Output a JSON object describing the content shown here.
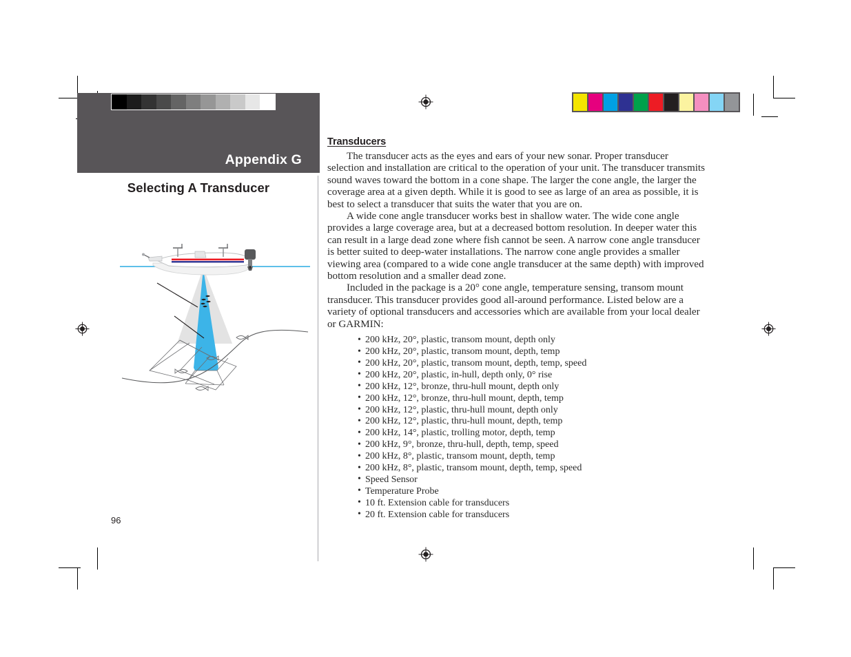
{
  "page": {
    "number": "96",
    "appendix_label": "Appendix G",
    "section_title": "Selecting A Transducer",
    "background_color": "#ffffff",
    "panel_color": "#585558"
  },
  "body": {
    "heading": "Transducers",
    "paragraphs": [
      "The transducer acts as the eyes and ears of your new sonar. Proper transducer selection and installation are critical to the operation of your unit. The transducer transmits sound waves toward the bottom in a cone shape. The larger the cone angle, the larger the coverage area at a given depth. While it is good to see as large of an area as possible, it is best to select a transducer that suits the water that you are on.",
      "A wide cone angle transducer works best in shallow water. The wide cone angle provides a large coverage area, but at a decreased bottom resolution. In deeper water this can result in a large dead zone where fish cannot be seen. A narrow cone angle transducer is better suited to deep-water installations. The narrow cone angle provides a smaller viewing area (compared to a wide cone angle transducer at the same depth) with improved bottom resolution and a smaller dead zone.",
      "Included in the package is a 20° cone angle, temperature sensing, transom mount transducer. This transducer provides good all-around performance. Listed below are a variety of optional transducers and accessories which are available from your local dealer or GARMIN:"
    ],
    "bullets": [
      "200 kHz, 20°, plastic, transom mount, depth only",
      "200 kHz, 20°, plastic, transom mount, depth, temp",
      "200 kHz, 20°, plastic, transom mount, depth, temp, speed",
      "200 kHz, 20°, plastic, in-hull, depth only, 0° rise",
      "200 kHz, 12°, bronze, thru-hull mount, depth only",
      "200 kHz, 12°, bronze, thru-hull mount, depth, temp",
      "200 kHz, 12°, plastic, thru-hull mount, depth only",
      "200 kHz, 12°, plastic, thru-hull mount, depth, temp",
      "200 kHz, 14°, plastic, trolling motor, depth, temp",
      "200 kHz, 9°, bronze, thru-hull, depth, temp, speed",
      "200 kHz, 8°, plastic, transom mount, depth, temp",
      "200 kHz, 8°, plastic, transom mount, depth, temp, speed",
      "Speed Sensor",
      "Temperature Probe",
      "10 ft. Extension cable for transducers",
      "20 ft. Extension cable for transducers"
    ]
  },
  "calibration": {
    "grayscale_swatches": [
      "#000000",
      "#1c1c1c",
      "#333333",
      "#4a4a4a",
      "#646464",
      "#7e7e7e",
      "#969696",
      "#b0b0b0",
      "#c9c9c9",
      "#e7e7e7",
      "#ffffff"
    ],
    "color_swatches": [
      "#f4e500",
      "#e6007e",
      "#00a0e3",
      "#2e3192",
      "#00a14b",
      "#ed1c24",
      "#231f20",
      "#fbf3a0",
      "#f48fc0",
      "#84d5f5",
      "#939598"
    ]
  },
  "illustration": {
    "name": "sonar-cone-diagram",
    "water_line_color": "#29abe2",
    "wide_cone_color": "#e3e3e3",
    "narrow_cone_color": "#3cb4e8",
    "hull_stripe_red": "#ed1c24",
    "hull_stripe_blue": "#2e3192",
    "bottom_contour_color": "#58595b"
  }
}
